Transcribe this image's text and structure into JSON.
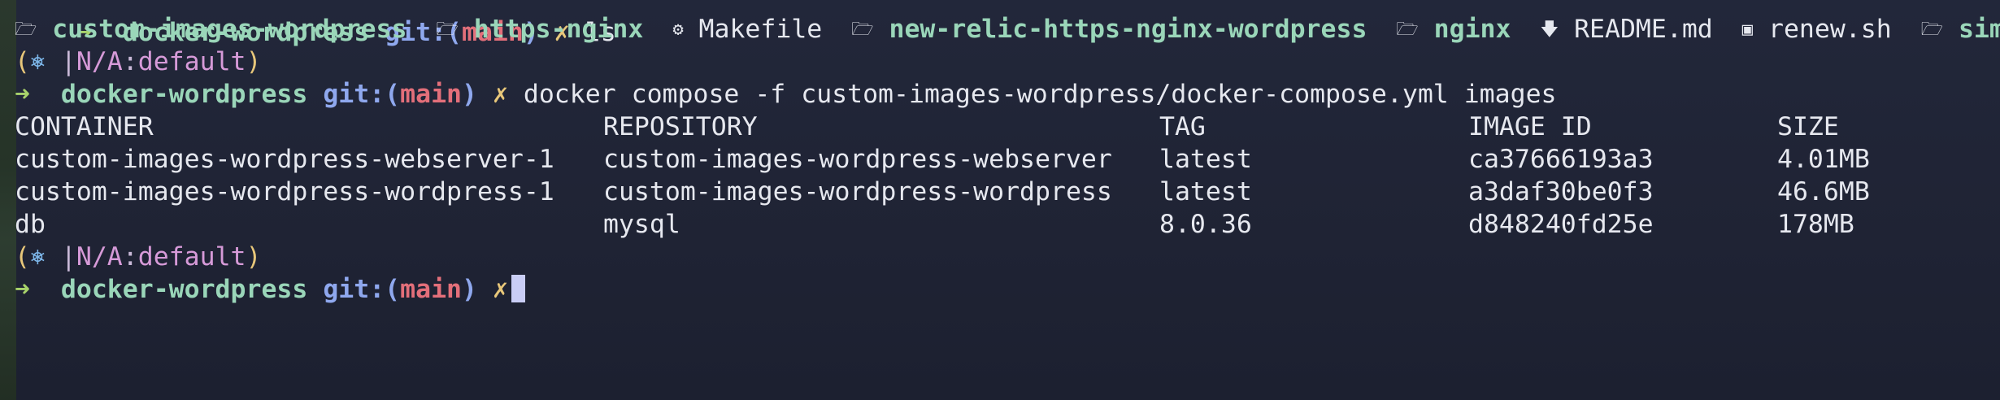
{
  "prev_prompt": {
    "arrow": "➜",
    "dir": "docker-wordpress",
    "git_label": "git:(",
    "branch": "main",
    "git_close": ")",
    "dirty": "✗",
    "command": "ls"
  },
  "ls_output": [
    {
      "icon": "🗁",
      "name": "custom-images-wordpress",
      "type": "dir"
    },
    {
      "icon": "🗁",
      "name": "https-nginx",
      "type": "dir"
    },
    {
      "icon": "⚙",
      "name": "Makefile",
      "type": "file"
    },
    {
      "icon": "🗁",
      "name": "new-relic-https-nginx-wordpress",
      "type": "dir"
    },
    {
      "icon": "🗁",
      "name": "nginx",
      "type": "dir"
    },
    {
      "icon": "🡇",
      "name": "README.md",
      "type": "file"
    },
    {
      "icon": "▣",
      "name": "renew.sh",
      "type": "file"
    },
    {
      "icon": "🗁",
      "name": "simp",
      "type": "dir"
    }
  ],
  "k8s_context": {
    "open": "(",
    "icon": "⎈",
    "sep": " |",
    "cluster": "N/A",
    "colon": ":",
    "namespace": "default",
    "close": ")"
  },
  "prompt": {
    "arrow": "➜",
    "dir": "docker-wordpress",
    "git_label": "git:(",
    "branch": "main",
    "git_close": ")",
    "dirty": "✗",
    "command": "docker compose -f custom-images-wordpress/docker-compose.yml images"
  },
  "images_table": {
    "headers": [
      "CONTAINER",
      "REPOSITORY",
      "TAG",
      "IMAGE ID",
      "SIZE"
    ],
    "rows": [
      [
        "custom-images-wordpress-webserver-1",
        "custom-images-wordpress-webserver",
        "latest",
        "ca37666193a3",
        "4.01MB"
      ],
      [
        "custom-images-wordpress-wordpress-1",
        "custom-images-wordpress-wordpress",
        "latest",
        "a3daf30be0f3",
        "46.6MB"
      ],
      [
        "db",
        "mysql",
        "8.0.36",
        "d848240fd25e",
        "178MB"
      ]
    ]
  },
  "colors": {
    "background": "#1f2233",
    "arrow": "#a8d36b",
    "directory": "#9ad6b9",
    "git": "#8fa8ee",
    "branch": "#e36f7a",
    "dirty": "#e8c77a",
    "cursor": "#c9cdf5"
  }
}
